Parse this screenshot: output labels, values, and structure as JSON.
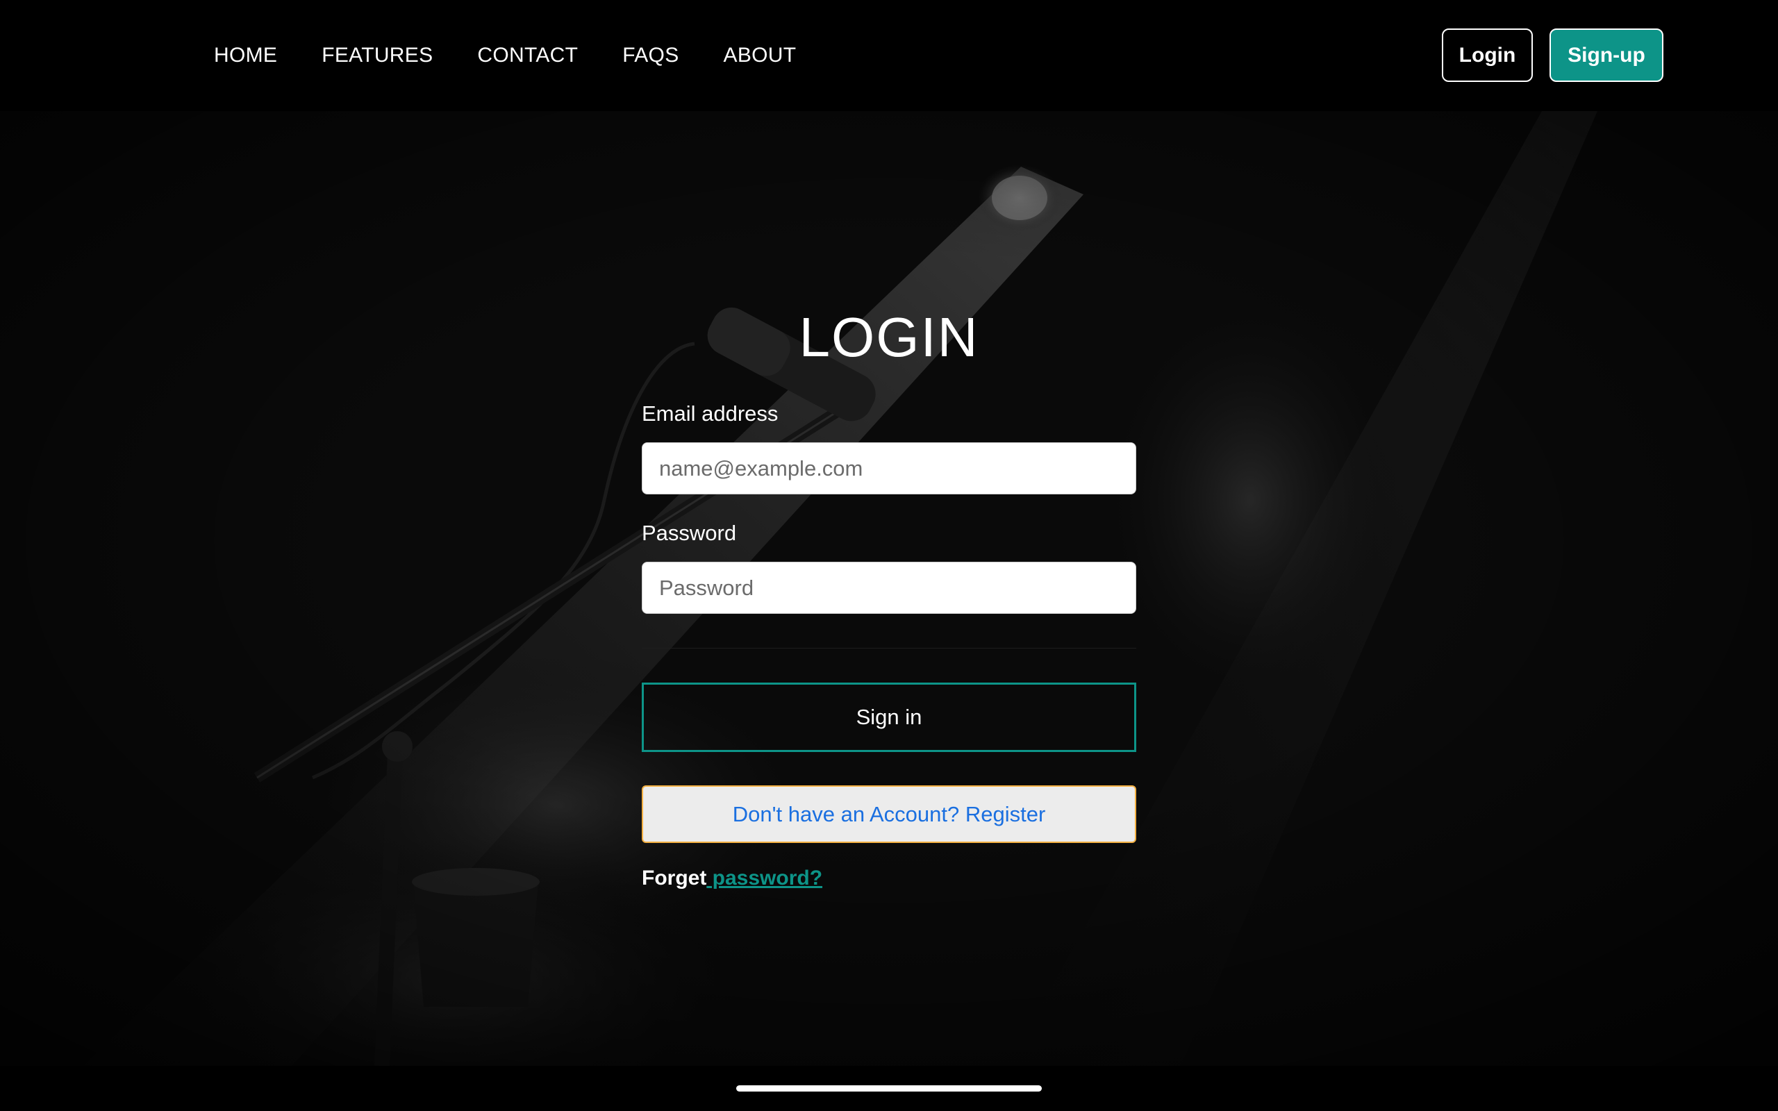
{
  "nav": {
    "links": [
      "HOME",
      "FEATURES",
      "CONTACT",
      "FAQS",
      "ABOUT"
    ],
    "login_label": "Login",
    "signup_label": "Sign-up"
  },
  "login": {
    "title": "LOGIN",
    "email_label": "Email address",
    "email_placeholder": "name@example.com",
    "email_value": "",
    "password_label": "Password",
    "password_placeholder": "Password",
    "password_value": "",
    "signin_label": "Sign in",
    "register_label": "Don't have an Account? Register",
    "forget_prefix": "Forget",
    "forget_link": " password?"
  },
  "colors": {
    "accent": "#0d9488",
    "register_border": "#f4b042",
    "register_text": "#1a6fe0",
    "background": "#000000"
  },
  "icons": {
    "hero_image": "microphone-stage-image"
  }
}
